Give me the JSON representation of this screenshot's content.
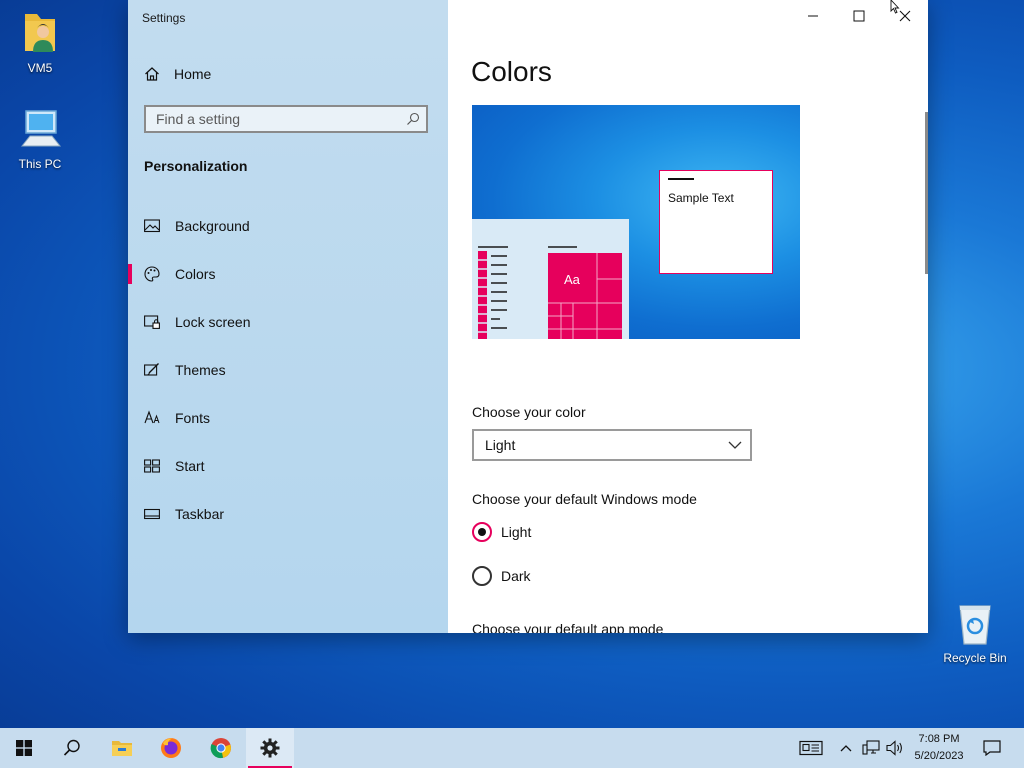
{
  "desktop": {
    "icons": [
      {
        "label": "VM5"
      },
      {
        "label": "This PC"
      },
      {
        "label": "Recycle Bin"
      }
    ]
  },
  "window": {
    "app_title": "Settings",
    "controls": {
      "minimize": "minimize-icon",
      "maximize": "maximize-icon",
      "close": "close-icon"
    }
  },
  "sidebar": {
    "home_label": "Home",
    "search_placeholder": "Find a setting",
    "section_heading": "Personalization",
    "items": [
      {
        "label": "Background",
        "icon": "picture-icon"
      },
      {
        "label": "Colors",
        "icon": "palette-icon",
        "active": true
      },
      {
        "label": "Lock screen",
        "icon": "lock-screen-icon"
      },
      {
        "label": "Themes",
        "icon": "themes-icon"
      },
      {
        "label": "Fonts",
        "icon": "fonts-icon"
      },
      {
        "label": "Start",
        "icon": "start-layout-icon"
      },
      {
        "label": "Taskbar",
        "icon": "taskbar-icon"
      }
    ]
  },
  "main": {
    "title": "Colors",
    "preview": {
      "sample_text": "Sample Text",
      "tile_text": "Aa"
    },
    "choose_color_label": "Choose your color",
    "choose_color_value": "Light",
    "windows_mode_label": "Choose your default Windows mode",
    "windows_mode_options": [
      {
        "label": "Light",
        "selected": true
      },
      {
        "label": "Dark",
        "selected": false
      }
    ],
    "app_mode_label": "Choose your default app mode"
  },
  "taskbar": {
    "apps": [
      "start-icon",
      "search-icon",
      "file-explorer-icon",
      "firefox-icon",
      "chrome-icon",
      "settings-icon"
    ],
    "clock": {
      "time": "7:08 PM",
      "date": "5/20/2023"
    }
  },
  "colors": {
    "accent": "#e6005c",
    "sidebar_bg": "#b4d6ee",
    "taskbar_bg": "#c7dcee"
  }
}
